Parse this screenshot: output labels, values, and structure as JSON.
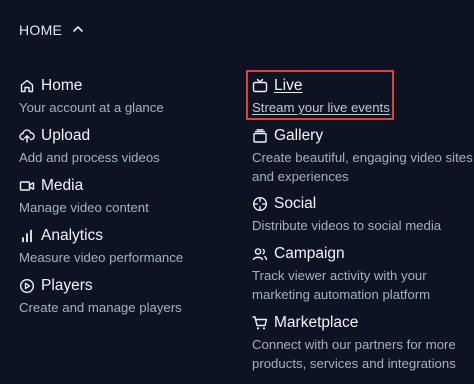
{
  "header": {
    "label": "HOME"
  },
  "left_items": [
    {
      "title": "Home",
      "desc": "Your account at a glance",
      "icon": "home-icon"
    },
    {
      "title": "Upload",
      "desc": "Add and process videos",
      "icon": "upload-cloud-icon"
    },
    {
      "title": "Media",
      "desc": "Manage video content",
      "icon": "video-camera-icon"
    },
    {
      "title": "Analytics",
      "desc": "Measure video performance",
      "icon": "bar-chart-icon"
    },
    {
      "title": "Players",
      "desc": "Create and manage players",
      "icon": "play-circle-icon"
    }
  ],
  "right_items": [
    {
      "title": "Live",
      "desc": "Stream your live events",
      "icon": "tv-icon"
    },
    {
      "title": "Gallery",
      "desc": "Create beautiful, engaging video sites and experiences",
      "icon": "gallery-icon"
    },
    {
      "title": "Social",
      "desc": "Distribute videos to social media",
      "icon": "aperture-icon"
    },
    {
      "title": "Campaign",
      "desc": "Track viewer activity with your marketing automation platform",
      "icon": "users-icon"
    },
    {
      "title": "Marketplace",
      "desc": "Connect with our partners for more products, services and integrations",
      "icon": "cart-icon"
    }
  ],
  "colors": {
    "background": "#0c1323",
    "highlight": "#e0452a",
    "muted_text": "#a7b0c0"
  }
}
